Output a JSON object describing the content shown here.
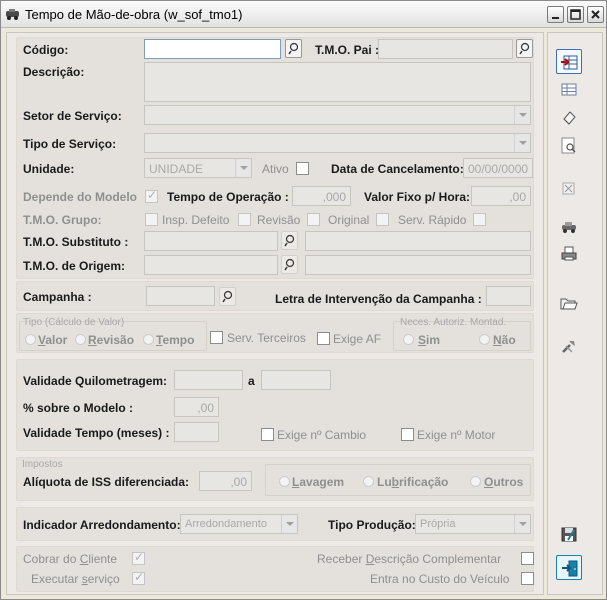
{
  "window": {
    "title": "Tempo de Mão-de-obra (w_sof_tmo1)",
    "minimize_icon": "minimize-icon",
    "maximize_icon": "maximize-icon",
    "close_icon": "close-icon"
  },
  "form": {
    "codigo": {
      "label": "Código:",
      "value": ""
    },
    "tmo_pai": {
      "label": "T.M.O. Pai :",
      "value": ""
    },
    "descricao": {
      "label": "Descrição:",
      "value": ""
    },
    "setor_servico": {
      "label": "Setor de Serviço:",
      "value": ""
    },
    "tipo_servico": {
      "label": "Tipo de Serviço:",
      "value": ""
    },
    "unidade": {
      "label": "Unidade:",
      "value": "UNIDADE"
    },
    "ativo": {
      "label": "Ativo",
      "checked": false
    },
    "data_cancelamento": {
      "label": "Data de Cancelamento:",
      "value": "00/00/0000"
    },
    "depende_modelo": {
      "label": "Depende do Modelo",
      "checked": true
    },
    "tempo_operacao": {
      "label": "Tempo de Operação :",
      "value": ",000"
    },
    "valor_fixo_hora": {
      "label": "Valor Fixo p/ Hora:",
      "value": ",00"
    },
    "tmo_grupo": {
      "label": "T.M.O. Grupo:"
    },
    "insp_defeito": {
      "label": "Insp. Defeito",
      "checked": false
    },
    "revisao_chk": {
      "label": "Revisão",
      "checked": false
    },
    "original": {
      "label": "Original",
      "checked": false
    },
    "serv_rapido": {
      "label": "Serv. Rápido",
      "checked": false
    },
    "tmo_substituto": {
      "label": "T.M.O. Substituto :",
      "value": "",
      "desc": ""
    },
    "tmo_origem": {
      "label": "T.M.O. de Origem:",
      "value": "",
      "desc": ""
    },
    "campanha": {
      "label": "Campanha :",
      "value": ""
    },
    "letra_intervencao": {
      "label": "Letra de Intervenção da Campanha :",
      "value": ""
    },
    "tipo_calculo": {
      "caption": "Tipo (Cálculo de Valor)",
      "options": [
        {
          "label": "Valor",
          "accel": "V",
          "rest": "alor"
        },
        {
          "label": "Revisão",
          "accel": "R",
          "rest": "evisão"
        },
        {
          "label": "Tempo",
          "accel": "T",
          "rest": "empo"
        }
      ]
    },
    "serv_terceiros": {
      "label": "Serv. Terceiros",
      "checked": false
    },
    "exige_af": {
      "label": "Exige AF",
      "checked": false
    },
    "neces_autoriz": {
      "caption": "Neces. Autoriz. Montad.",
      "options": [
        {
          "label": "Sim",
          "accel": "S",
          "rest": "im"
        },
        {
          "label": "Não",
          "accel": "N",
          "rest": "ão"
        }
      ]
    },
    "validade_km": {
      "label": "Validade Quilometragem:",
      "from": "",
      "sep": "a",
      "to": ""
    },
    "pct_modelo": {
      "label": "% sobre o Modelo :",
      "value": ",00"
    },
    "validade_tempo": {
      "label": "Validade Tempo (meses) :",
      "value": ""
    },
    "exige_cambio": {
      "label": "Exige nº Cambio",
      "checked": false
    },
    "exige_motor": {
      "label": "Exige nº Motor",
      "checked": false
    },
    "impostos": {
      "caption": "Impostos",
      "aliquota_iss": {
        "label": "Alíquota de ISS diferenciada:",
        "value": ",00"
      },
      "options": [
        {
          "label": "Lavagem",
          "accel": "L",
          "rest": "avagem"
        },
        {
          "label": "Lubrificação",
          "pre": "Lu",
          "accel": "b",
          "rest": "rificação"
        },
        {
          "label": "Outros",
          "accel": "O",
          "rest": "utros"
        }
      ]
    },
    "indicador_arredondamento": {
      "label": "Indicador Arredondamento:",
      "value": "Arredondamento"
    },
    "tipo_producao": {
      "label": "Tipo Produção:",
      "value": "Própria"
    },
    "cobrar_cliente": {
      "label": "Cobrar do Cliente",
      "pre": "Cobrar do ",
      "accel": "C",
      "rest": "liente",
      "checked": true
    },
    "executar_servico": {
      "label": "Executar serviço",
      "pre": "Executar ",
      "accel": "s",
      "rest": "erviço",
      "checked": true
    },
    "receber_descricao": {
      "label": "Receber Descrição Complementar",
      "pre": "Receber ",
      "accel": "D",
      "rest": "escrição Complementar",
      "checked": false
    },
    "entra_custo": {
      "label": "Entra no Custo do Veículo",
      "checked": false
    }
  },
  "toolbar": {
    "buttons": [
      {
        "name": "insert-row-icon"
      },
      {
        "name": "table-icon"
      },
      {
        "name": "eraser-icon"
      },
      {
        "name": "preview-icon"
      },
      {
        "name": "retrieve-icon"
      },
      {
        "name": "vehicle-icon"
      },
      {
        "name": "print-icon"
      },
      {
        "name": "open-folder-icon"
      },
      {
        "name": "tools-icon"
      },
      {
        "name": "save-disk-icon"
      },
      {
        "name": "exit-door-icon"
      }
    ]
  },
  "colors": {
    "background": "#ece9e6",
    "section": "#e4e1dc",
    "disabled_text": "#a8a8a8",
    "label": "#1a1a1a",
    "accent": "#1b7fa8"
  }
}
